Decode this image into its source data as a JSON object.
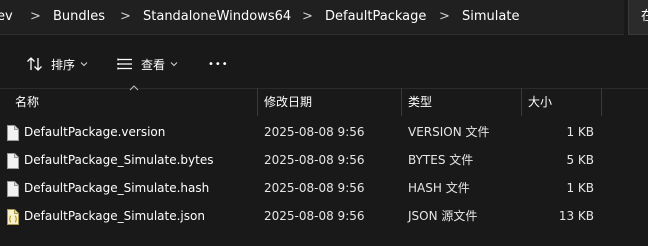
{
  "address": {
    "crumbs": [
      "ev",
      "Bundles",
      "StandaloneWindows64",
      "DefaultPackage",
      "Simulate"
    ],
    "search_partial": "在"
  },
  "toolbar": {
    "sort_label": "排序",
    "view_label": "查看",
    "more_label": "•••"
  },
  "columns": {
    "name": "名称",
    "modified": "修改日期",
    "type": "类型",
    "size": "大小"
  },
  "files": [
    {
      "name": "DefaultPackage.version",
      "modified": "2025-08-08 9:56",
      "type": "VERSION 文件",
      "size": "1 KB",
      "icon": "file-icon"
    },
    {
      "name": "DefaultPackage_Simulate.bytes",
      "modified": "2025-08-08 9:56",
      "type": "BYTES 文件",
      "size": "5 KB",
      "icon": "file-icon"
    },
    {
      "name": "DefaultPackage_Simulate.hash",
      "modified": "2025-08-08 9:56",
      "type": "HASH 文件",
      "size": "1 KB",
      "icon": "file-icon"
    },
    {
      "name": "DefaultPackage_Simulate.json",
      "modified": "2025-08-08 9:56",
      "type": "JSON 源文件",
      "size": "13 KB",
      "icon": "json-file-icon"
    }
  ]
}
